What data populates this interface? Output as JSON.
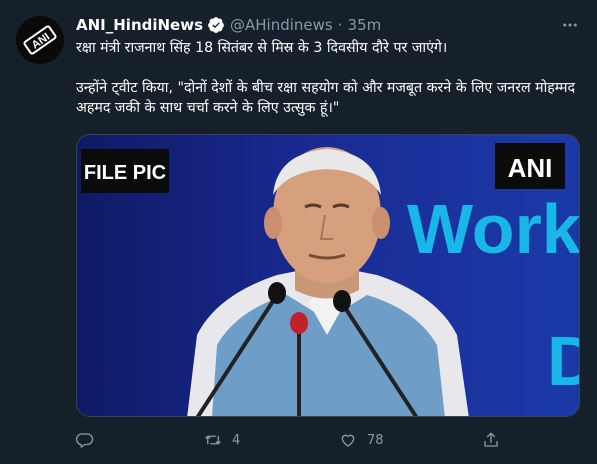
{
  "tweet": {
    "author_name": "ANI_HindiNews",
    "handle": "@AHindinews",
    "separator": "·",
    "time": "35m",
    "text_line1": "रक्षा मंत्री राजनाथ सिंह 18 सितंबर से मिस्र के 3 दिवसीय दौरे पर जाएंगे।",
    "text_line2": "उन्होंने ट्वीट किया, \"दोनों देशों के बीच रक्षा सहयोग को और मजबूत करने के लिए जनरल मोहम्मद अहमद जकी के साथ चर्चा करने के लिए उत्सुक हूं।\"",
    "media": {
      "file_pic_label": "FILE PIC",
      "ani_label": "ANI",
      "backdrop_text_1": "Work",
      "backdrop_text_2": "D"
    },
    "avatar_label": "ANI",
    "actions": {
      "reply_icon": "reply-icon",
      "retweet_icon": "retweet-icon",
      "retweet_count": "4",
      "like_icon": "heart-icon",
      "like_count": "78",
      "share_icon": "share-icon"
    }
  },
  "colors": {
    "background": "#15202b",
    "muted": "#8899a6",
    "verified": "#1da1f2",
    "media_blue": "#1a2a8c",
    "media_cyan": "#18b9e6"
  }
}
